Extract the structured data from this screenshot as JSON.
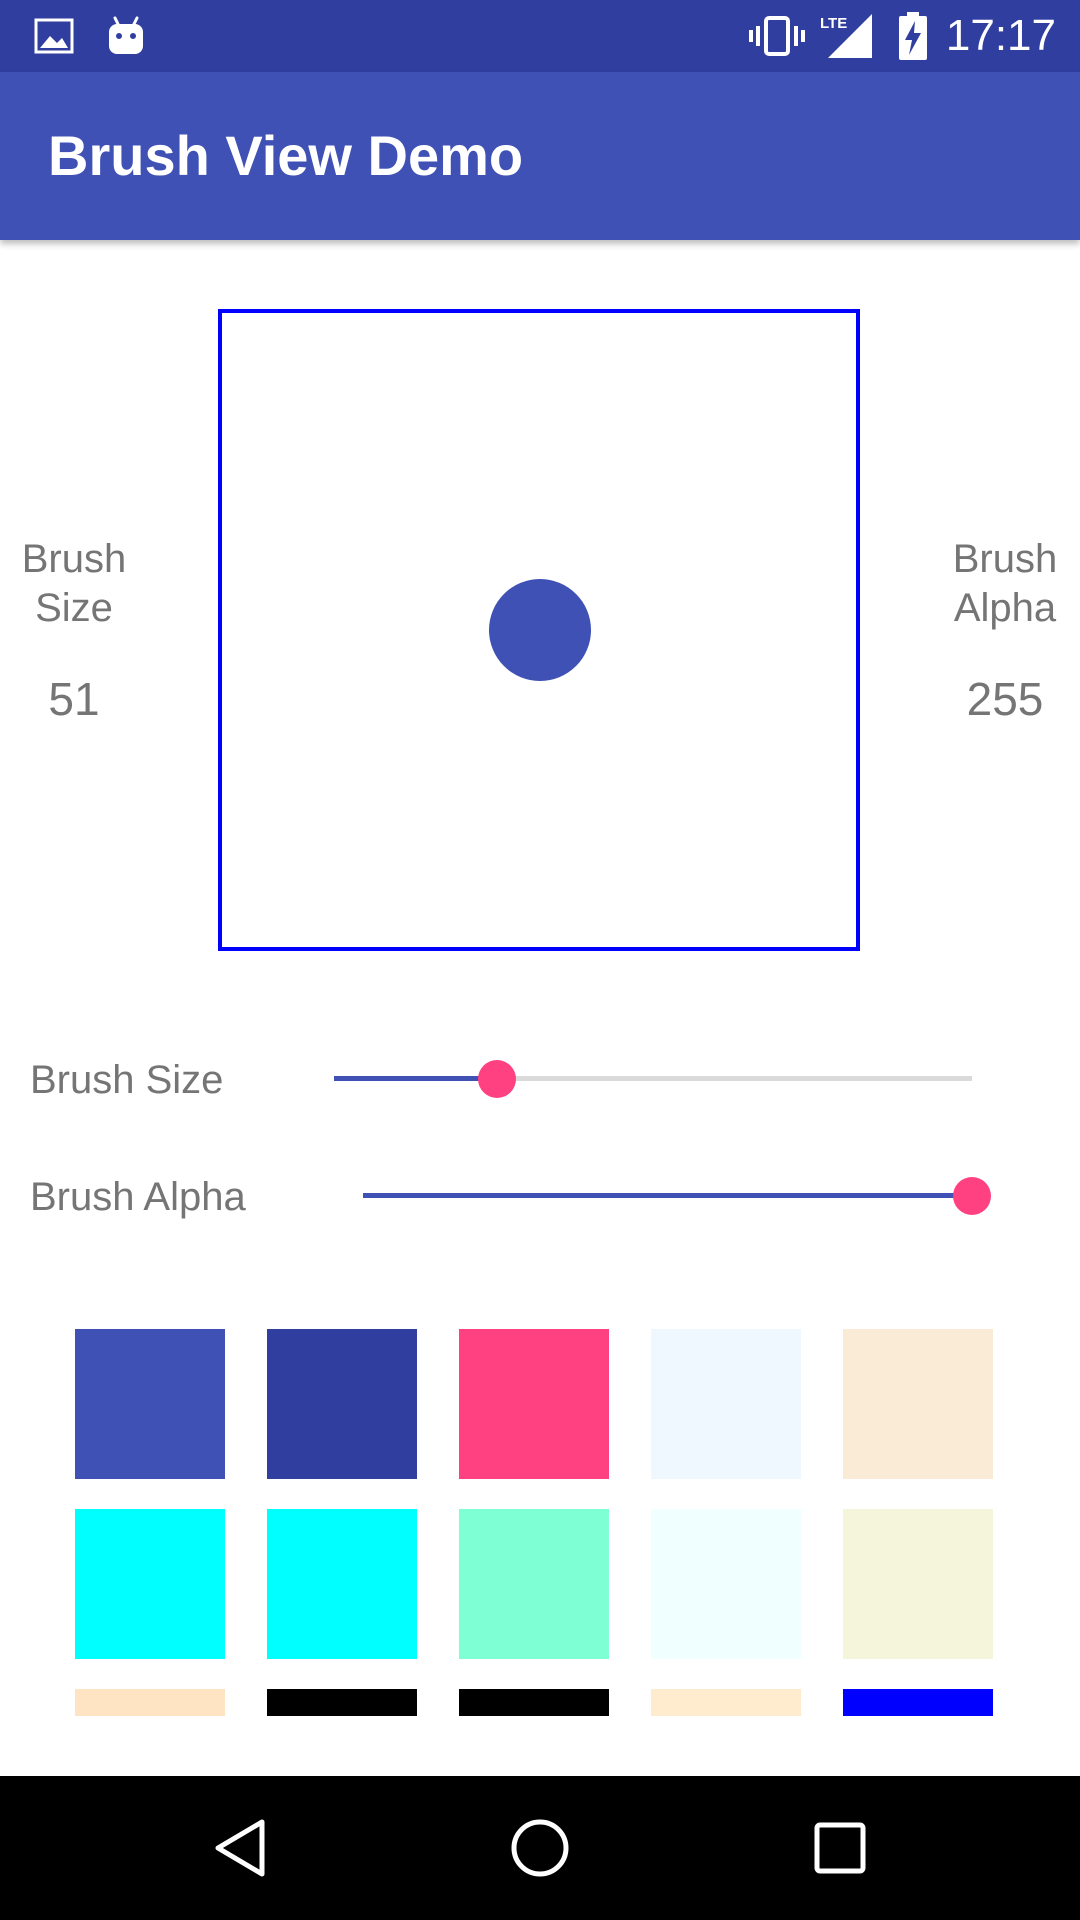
{
  "status_bar": {
    "time": "17:17",
    "network_label": "LTE",
    "icons": [
      "image-icon",
      "android-icon",
      "vibrate-icon",
      "signal-icon",
      "battery-charging-icon"
    ]
  },
  "app_bar": {
    "title": "Brush View Demo"
  },
  "brush_size": {
    "side_label": "Brush\nSize",
    "value": "51",
    "slider_label": "Brush Size",
    "level": 0.255
  },
  "brush_alpha": {
    "side_label": "Brush\nAlpha",
    "value": "255",
    "slider_label": "Brush Alpha",
    "level": 1.0
  },
  "preview": {
    "color": "#3F51B5"
  },
  "colors": {
    "accent": "#FF4081",
    "primary": "#3F51B5",
    "primary_dark": "#303F9F",
    "canvas_border": "#0000FF"
  },
  "swatches": [
    [
      "#3F51B5",
      "#303F9F",
      "#FF4081",
      "#F0F8FF",
      "#FAEBD7"
    ],
    [
      "#00FFFF",
      "#00FFFF",
      "#7FFFD4",
      "#F0FFFF",
      "#F5F5DC"
    ],
    [
      "#FFE4C4",
      "#000000",
      "#000000",
      "#FFEBCD",
      "#0000FF"
    ]
  ],
  "nav_bar": {
    "buttons": [
      "back-icon",
      "home-icon",
      "recents-icon"
    ]
  }
}
